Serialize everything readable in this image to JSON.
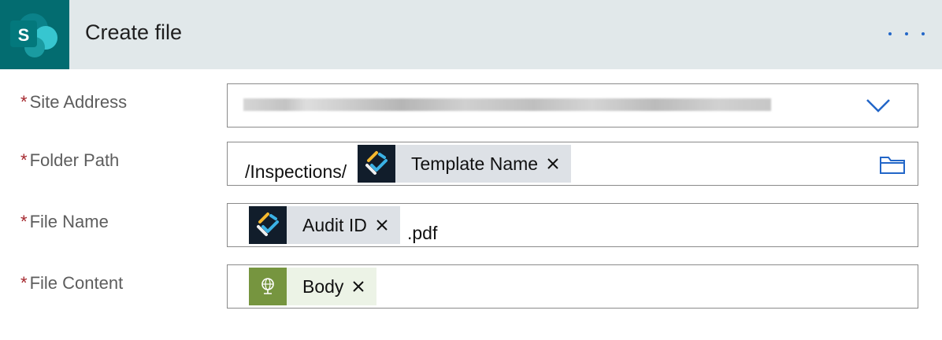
{
  "header": {
    "title": "Create file",
    "logo_letter": "S",
    "logo_color": "#036c70",
    "more_icon": "ellipsis-icon"
  },
  "fields": {
    "site_address": {
      "label": "Site Address",
      "required": "*",
      "value": ""
    },
    "folder_path": {
      "label": "Folder Path",
      "required": "*",
      "prefix": "/Inspections/",
      "token": "Template Name"
    },
    "file_name": {
      "label": "File Name",
      "required": "*",
      "token": "Audit ID",
      "suffix": ".pdf"
    },
    "file_content": {
      "label": "File Content",
      "required": "*",
      "token": "Body"
    }
  },
  "colors": {
    "accent": "#2266c8",
    "required": "#a4262c",
    "token_dark_icon_bg": "#111d2b",
    "token_green_icon_bg": "#76953f"
  }
}
